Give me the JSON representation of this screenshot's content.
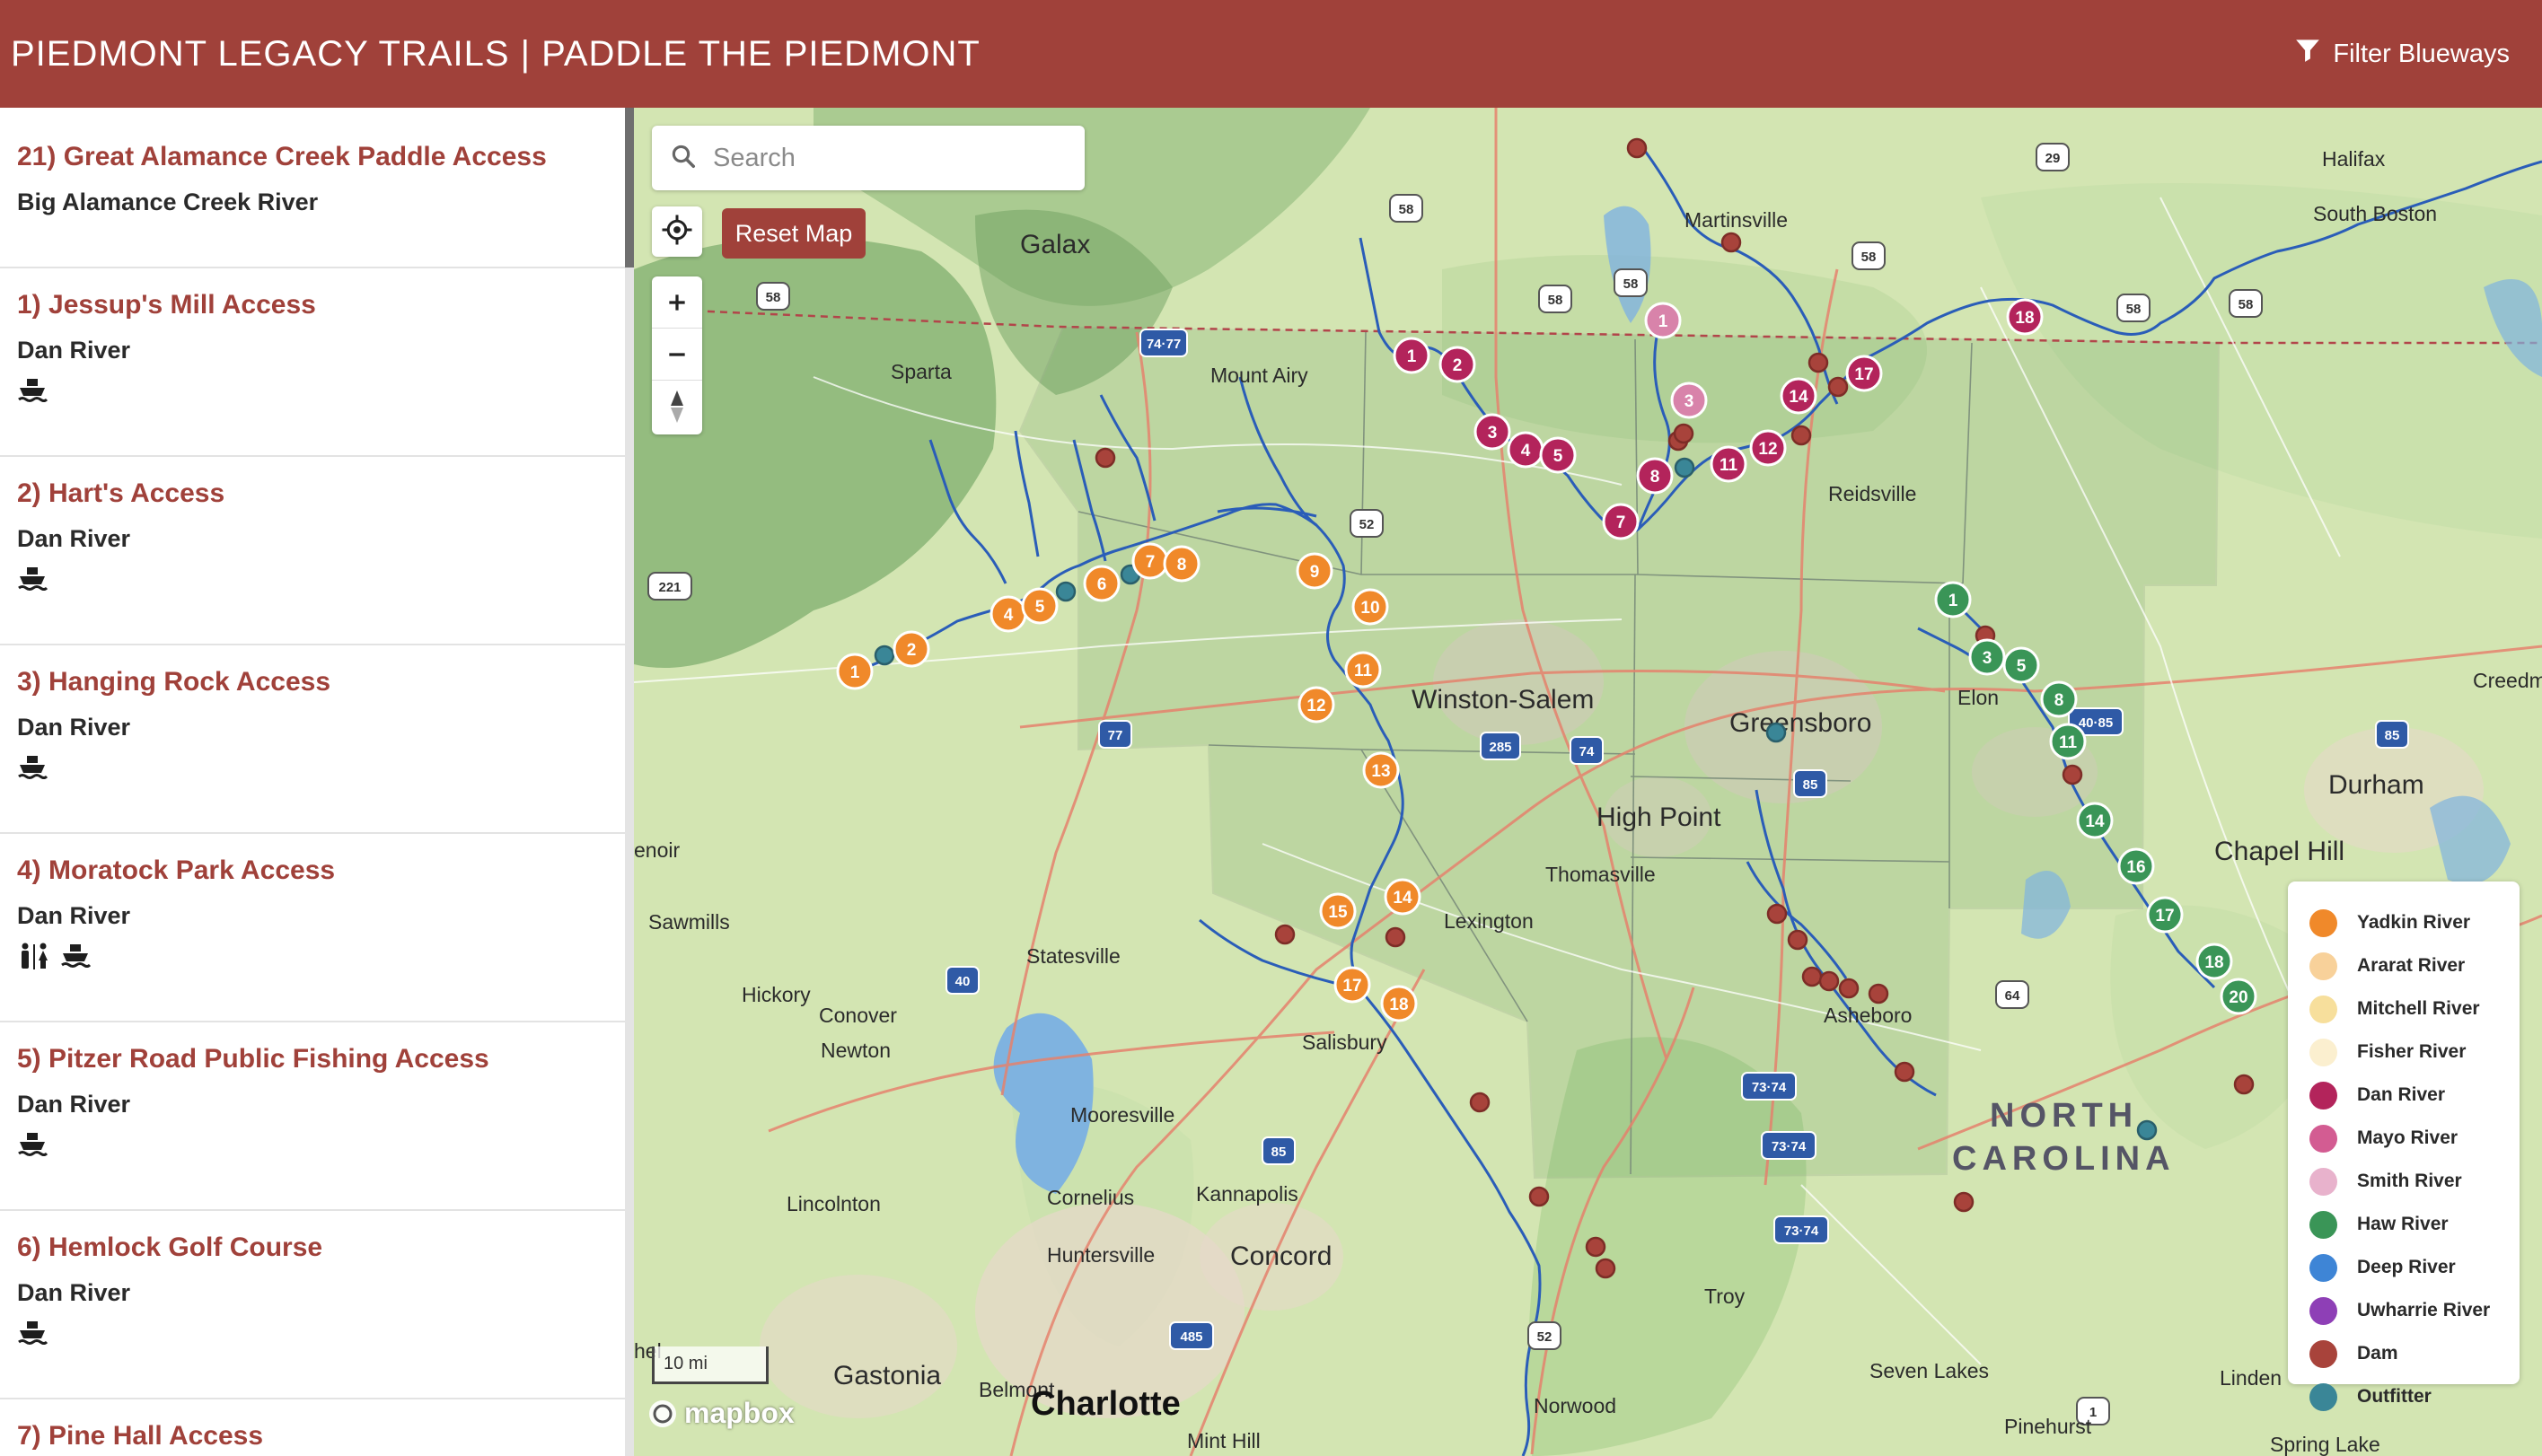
{
  "header": {
    "title": "PIEDMONT LEGACY TRAILS | PADDLE THE PIEDMONT",
    "filter_label": "Filter Blueways"
  },
  "sidebar": {
    "items": [
      {
        "title": "21) Great Alamance Creek Paddle Access",
        "river": "Big Alamance Creek River",
        "amenities": []
      },
      {
        "title": "1) Jessup's Mill Access",
        "river": "Dan River",
        "amenities": [
          "boat-launch"
        ]
      },
      {
        "title": "2) Hart's Access",
        "river": "Dan River",
        "amenities": [
          "boat-launch"
        ]
      },
      {
        "title": "3) Hanging Rock Access",
        "river": "Dan River",
        "amenities": [
          "boat-launch"
        ]
      },
      {
        "title": "4) Moratock Park Access",
        "river": "Dan River",
        "amenities": [
          "restrooms",
          "boat-launch"
        ]
      },
      {
        "title": "5) Pitzer Road Public Fishing Access",
        "river": "Dan River",
        "amenities": [
          "boat-launch"
        ]
      },
      {
        "title": "6) Hemlock Golf Course",
        "river": "Dan River",
        "amenities": [
          "boat-launch"
        ]
      },
      {
        "title": "7) Pine Hall Access",
        "river": "",
        "amenities": []
      }
    ]
  },
  "map": {
    "search_placeholder": "Search",
    "reset_label": "Reset Map",
    "zoom_in_label": "+",
    "zoom_out_label": "−",
    "scale_label": "10 mi",
    "attribution": "mapbox",
    "state_label_line1": "NORTH",
    "state_label_line2": "CAROLINA",
    "places": [
      {
        "name": "Galax",
        "cls": "city"
      },
      {
        "name": "Halifax"
      },
      {
        "name": "Martinsville"
      },
      {
        "name": "South Boston"
      },
      {
        "name": "Sparta"
      },
      {
        "name": "Mount Airy"
      },
      {
        "name": "Reidsville"
      },
      {
        "name": "Winston-Salem",
        "cls": "city"
      },
      {
        "name": "Greensboro",
        "cls": "city"
      },
      {
        "name": "Elon"
      },
      {
        "name": "Durham",
        "cls": "city"
      },
      {
        "name": "Creedmo"
      },
      {
        "name": "High Point",
        "cls": "city"
      },
      {
        "name": "Chapel Hill",
        "cls": "city"
      },
      {
        "name": "enoir"
      },
      {
        "name": "Thomasville"
      },
      {
        "name": "Sawmills"
      },
      {
        "name": "Lexington"
      },
      {
        "name": "Statesville"
      },
      {
        "name": "Hickory"
      },
      {
        "name": "Conover"
      },
      {
        "name": "Newton"
      },
      {
        "name": "Salisbury"
      },
      {
        "name": "Asheboro"
      },
      {
        "name": "Mooresville"
      },
      {
        "name": "Lincolnton"
      },
      {
        "name": "Cornelius"
      },
      {
        "name": "Kannapolis"
      },
      {
        "name": "Huntersville"
      },
      {
        "name": "Concord",
        "cls": "city"
      },
      {
        "name": "Troy"
      },
      {
        "name": "Gastonia",
        "cls": "city"
      },
      {
        "name": "Belmont"
      },
      {
        "name": "Charlotte",
        "cls": "big"
      },
      {
        "name": "Norwood"
      },
      {
        "name": "Seven Lakes"
      },
      {
        "name": "Linden"
      },
      {
        "name": "Pinehurst"
      },
      {
        "name": "Mint Hill"
      },
      {
        "name": "Spring Lake"
      },
      {
        "name": "hel"
      }
    ],
    "highway_shields": [
      "58",
      "29",
      "58",
      "58",
      "58",
      "58",
      "58",
      "58",
      "74·77",
      "52",
      "221",
      "77",
      "285",
      "74",
      "85",
      "40·85",
      "85",
      "40",
      "64",
      "85",
      "73·74",
      "73·74",
      "73·74",
      "485",
      "52",
      "1"
    ]
  },
  "legend": {
    "items": [
      {
        "label": "Yadkin River",
        "color": "#f0892a"
      },
      {
        "label": "Ararat River",
        "color": "#f8d19a"
      },
      {
        "label": "Mitchell River",
        "color": "#f7df9c"
      },
      {
        "label": "Fisher River",
        "color": "#fbefcf"
      },
      {
        "label": "Dan River",
        "color": "#b3245b"
      },
      {
        "label": "Mayo River",
        "color": "#d35c92"
      },
      {
        "label": "Smith River",
        "color": "#e8b2cc"
      },
      {
        "label": "Haw River",
        "color": "#3a9557"
      },
      {
        "label": "Deep River",
        "color": "#3e85d6"
      },
      {
        "label": "Uwharrie River",
        "color": "#8e3fb6"
      },
      {
        "label": "Dam",
        "color": "#a8433b"
      },
      {
        "label": "Outfitter",
        "color": "#3a8697"
      }
    ]
  },
  "markers": {
    "yadkin": [
      "1",
      "2",
      "4",
      "5",
      "6",
      "7",
      "8",
      "9",
      "10",
      "11",
      "12",
      "13",
      "14",
      "15",
      "17",
      "18"
    ],
    "dan": [
      "1",
      "2",
      "3",
      "4",
      "5",
      "7",
      "8",
      "11",
      "12",
      "14",
      "17",
      "18"
    ],
    "smith": [
      "1",
      "3"
    ],
    "haw": [
      "1",
      "3",
      "5",
      "8",
      "11",
      "14",
      "16",
      "17",
      "18",
      "20"
    ]
  },
  "colors": {
    "brand": "#a0413a",
    "yadkin": "#f0892a",
    "dan": "#b3245b",
    "smith": "#d883aa",
    "haw": "#3a9557",
    "dam": "#a8433b",
    "outfitter": "#3a8697",
    "river_line": "#2a5db8"
  }
}
